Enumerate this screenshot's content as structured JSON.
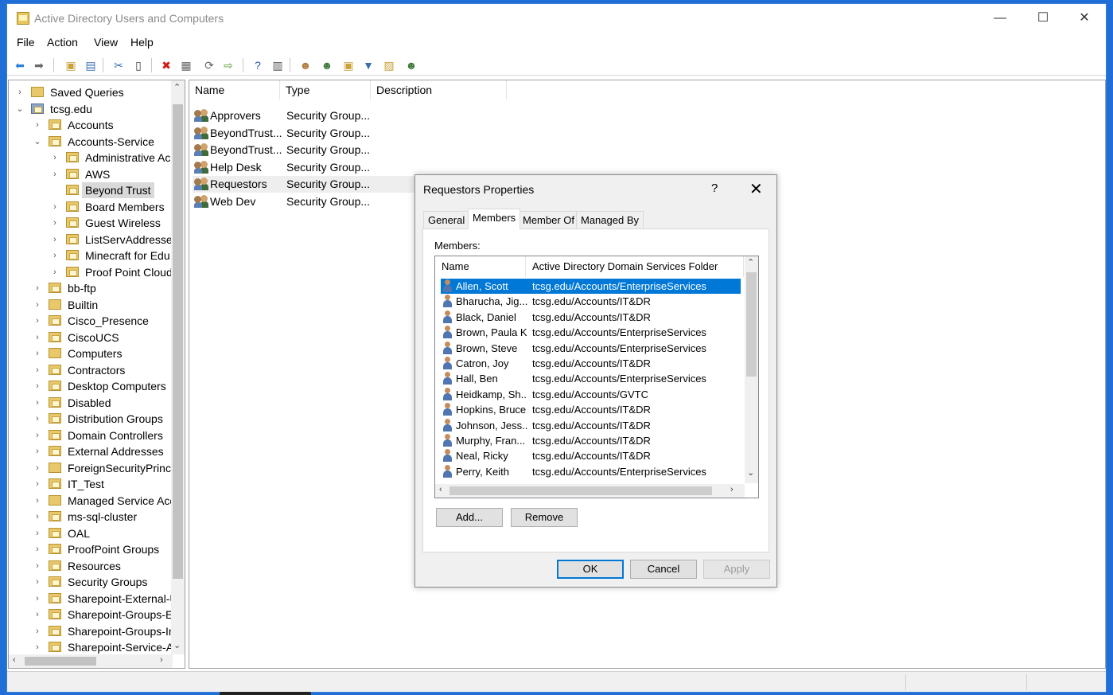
{
  "window": {
    "title": "Active Directory Users and Computers",
    "minimize": "—",
    "maximize": "☐",
    "close": "✕"
  },
  "menu": [
    "File",
    "Action",
    "View",
    "Help"
  ],
  "toolbar": [
    {
      "name": "back-icon",
      "glyph": "⬅",
      "color": "#2a7fd4"
    },
    {
      "name": "forward-icon",
      "glyph": "➡",
      "color": "#6a6a6a"
    },
    {
      "name": "up-folder-icon",
      "glyph": "▣",
      "color": "#c9a13b"
    },
    {
      "name": "console-tree-icon",
      "glyph": "▤",
      "color": "#3c6fb2"
    },
    {
      "name": "cut-icon",
      "glyph": "✂",
      "color": "#3c6fb2"
    },
    {
      "name": "copy-icon",
      "glyph": "▯",
      "color": "#444"
    },
    {
      "name": "delete-icon",
      "glyph": "✖",
      "color": "#d11a1a"
    },
    {
      "name": "properties-icon",
      "glyph": "▦",
      "color": "#666"
    },
    {
      "name": "refresh-icon",
      "glyph": "⟳",
      "color": "#666"
    },
    {
      "name": "export-icon",
      "glyph": "⇨",
      "color": "#5a9a2e"
    },
    {
      "name": "help-icon",
      "glyph": "?",
      "color": "#2755b8"
    },
    {
      "name": "details-view-icon",
      "glyph": "▥",
      "color": "#555"
    },
    {
      "name": "new-user-icon",
      "glyph": "☻",
      "color": "#b07a3a"
    },
    {
      "name": "new-group-icon",
      "glyph": "☻",
      "color": "#3d7a3a"
    },
    {
      "name": "new-ou-icon",
      "glyph": "▣",
      "color": "#c9a13b"
    },
    {
      "name": "filter-icon",
      "glyph": "▼",
      "color": "#3c6fb2"
    },
    {
      "name": "find-icon",
      "glyph": "▨",
      "color": "#c9a13b"
    },
    {
      "name": "add-to-group-icon",
      "glyph": "☻",
      "color": "#3d7a3a"
    }
  ],
  "tree": [
    {
      "label": "Saved Queries",
      "level": 0,
      "chevron": "›",
      "icon": "plain"
    },
    {
      "label": "tcsg.edu",
      "level": 0,
      "chevron": "⌄",
      "icon": "domain"
    },
    {
      "label": "Accounts",
      "level": 1,
      "chevron": "›",
      "icon": "ou"
    },
    {
      "label": "Accounts-Service",
      "level": 1,
      "chevron": "⌄",
      "icon": "ou"
    },
    {
      "label": "Administrative Ac",
      "level": 2,
      "chevron": "›",
      "icon": "ou"
    },
    {
      "label": "AWS",
      "level": 2,
      "chevron": "›",
      "icon": "ou"
    },
    {
      "label": "Beyond Trust",
      "level": 2,
      "chevron": "",
      "icon": "ou",
      "selected": true
    },
    {
      "label": "Board Members",
      "level": 2,
      "chevron": "›",
      "icon": "ou"
    },
    {
      "label": "Guest Wireless",
      "level": 2,
      "chevron": "›",
      "icon": "ou"
    },
    {
      "label": "ListServAddresses",
      "level": 2,
      "chevron": "›",
      "icon": "ou"
    },
    {
      "label": "Minecraft for Edu",
      "level": 2,
      "chevron": "›",
      "icon": "ou"
    },
    {
      "label": "Proof Point Cloud",
      "level": 2,
      "chevron": "›",
      "icon": "ou"
    },
    {
      "label": "bb-ftp",
      "level": 1,
      "chevron": "›",
      "icon": "ou"
    },
    {
      "label": "Builtin",
      "level": 1,
      "chevron": "›",
      "icon": "plain"
    },
    {
      "label": "Cisco_Presence",
      "level": 1,
      "chevron": "›",
      "icon": "ou"
    },
    {
      "label": "CiscoUCS",
      "level": 1,
      "chevron": "›",
      "icon": "ou"
    },
    {
      "label": "Computers",
      "level": 1,
      "chevron": "›",
      "icon": "plain"
    },
    {
      "label": "Contractors",
      "level": 1,
      "chevron": "›",
      "icon": "ou"
    },
    {
      "label": "Desktop Computers",
      "level": 1,
      "chevron": "›",
      "icon": "ou"
    },
    {
      "label": "Disabled",
      "level": 1,
      "chevron": "›",
      "icon": "ou"
    },
    {
      "label": "Distribution Groups",
      "level": 1,
      "chevron": "›",
      "icon": "ou"
    },
    {
      "label": "Domain Controllers",
      "level": 1,
      "chevron": "›",
      "icon": "ou"
    },
    {
      "label": "External Addresses",
      "level": 1,
      "chevron": "›",
      "icon": "ou"
    },
    {
      "label": "ForeignSecurityPrinci",
      "level": 1,
      "chevron": "›",
      "icon": "plain"
    },
    {
      "label": "IT_Test",
      "level": 1,
      "chevron": "›",
      "icon": "ou"
    },
    {
      "label": "Managed Service Acc",
      "level": 1,
      "chevron": "›",
      "icon": "plain"
    },
    {
      "label": "ms-sql-cluster",
      "level": 1,
      "chevron": "›",
      "icon": "ou"
    },
    {
      "label": "OAL",
      "level": 1,
      "chevron": "›",
      "icon": "ou"
    },
    {
      "label": "ProofPoint Groups",
      "level": 1,
      "chevron": "›",
      "icon": "ou"
    },
    {
      "label": "Resources",
      "level": 1,
      "chevron": "›",
      "icon": "ou"
    },
    {
      "label": "Security Groups",
      "level": 1,
      "chevron": "›",
      "icon": "ou"
    },
    {
      "label": "Sharepoint-External-U",
      "level": 1,
      "chevron": "›",
      "icon": "ou"
    },
    {
      "label": "Sharepoint-Groups-Ex",
      "level": 1,
      "chevron": "›",
      "icon": "ou"
    },
    {
      "label": "Sharepoint-Groups-In",
      "level": 1,
      "chevron": "›",
      "icon": "ou"
    },
    {
      "label": "Sharepoint-Service-A",
      "level": 1,
      "chevron": "›",
      "icon": "ou"
    }
  ],
  "tree_scroll": {
    "up": "⌃",
    "down": "⌄",
    "left": "‹",
    "right": "›"
  },
  "list": {
    "columns": [
      "Name",
      "Type",
      "Description"
    ],
    "rows": [
      {
        "name": "Approvers",
        "type": "Security Group..."
      },
      {
        "name": "BeyondTrust...",
        "type": "Security Group..."
      },
      {
        "name": "BeyondTrust...",
        "type": "Security Group..."
      },
      {
        "name": "Help Desk",
        "type": "Security Group..."
      },
      {
        "name": "Requestors",
        "type": "Security Group...",
        "highlighted": true
      },
      {
        "name": "Web Dev",
        "type": "Security Group..."
      }
    ]
  },
  "dialog": {
    "title": "Requestors Properties",
    "help": "?",
    "close": "✕",
    "tabs": [
      "General",
      "Members",
      "Member Of",
      "Managed By"
    ],
    "active_tab": "Members",
    "members_label": "Members:",
    "columns": [
      "Name",
      "Active Directory Domain Services Folder"
    ],
    "members": [
      {
        "name": "Allen, Scott",
        "folder": "tcsg.edu/Accounts/EnterpriseServices",
        "selected": true
      },
      {
        "name": "Bharucha, Jig...",
        "folder": "tcsg.edu/Accounts/IT&DR"
      },
      {
        "name": "Black, Daniel",
        "folder": "tcsg.edu/Accounts/IT&DR"
      },
      {
        "name": "Brown, Paula K.",
        "folder": "tcsg.edu/Accounts/EnterpriseServices"
      },
      {
        "name": "Brown, Steve",
        "folder": "tcsg.edu/Accounts/EnterpriseServices"
      },
      {
        "name": "Catron, Joy",
        "folder": "tcsg.edu/Accounts/IT&DR"
      },
      {
        "name": "Hall, Ben",
        "folder": "tcsg.edu/Accounts/EnterpriseServices"
      },
      {
        "name": "Heidkamp, Sh...",
        "folder": "tcsg.edu/Accounts/GVTC"
      },
      {
        "name": "Hopkins, Bruce",
        "folder": "tcsg.edu/Accounts/IT&DR"
      },
      {
        "name": "Johnson, Jess...",
        "folder": "tcsg.edu/Accounts/IT&DR"
      },
      {
        "name": "Murphy, Fran...",
        "folder": "tcsg.edu/Accounts/IT&DR"
      },
      {
        "name": "Neal, Ricky",
        "folder": "tcsg.edu/Accounts/IT&DR"
      },
      {
        "name": "Perry, Keith",
        "folder": "tcsg.edu/Accounts/EnterpriseServices"
      }
    ],
    "scroll": {
      "up": "⌃",
      "down": "⌄",
      "left": "‹",
      "right": "›"
    },
    "add_label": "Add...",
    "remove_label": "Remove",
    "ok_label": "OK",
    "cancel_label": "Cancel",
    "apply_label": "Apply"
  },
  "colors": {
    "selection": "#0078d7",
    "tree_selection": "#d9d9d9",
    "desktop": "#1f6fd6"
  }
}
